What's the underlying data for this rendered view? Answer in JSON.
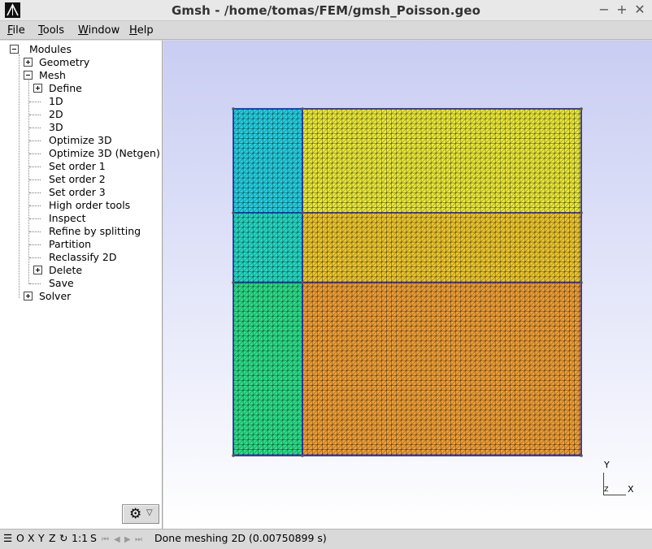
{
  "window": {
    "title": "Gmsh - /home/tomas/FEM/gmsh_Poisson.geo",
    "minimize": "−",
    "maximize": "+",
    "close": "✕"
  },
  "menu": {
    "file": "File",
    "tools": "Tools",
    "window": "Window",
    "help": "Help"
  },
  "tree": {
    "modules": "Modules",
    "geometry": "Geometry",
    "mesh": "Mesh",
    "define": "Define",
    "1d": "1D",
    "2d": "2D",
    "3d": "3D",
    "optimize3d": "Optimize 3D",
    "optimize3d_netgen": "Optimize 3D (Netgen)",
    "set_order_1": "Set order 1",
    "set_order_2": "Set order 2",
    "set_order_3": "Set order 3",
    "high_order_tools": "High order tools",
    "inspect": "Inspect",
    "refine_by_splitting": "Refine by splitting",
    "partition": "Partition",
    "reclassify_2d": "Reclassify 2D",
    "delete": "Delete",
    "save": "Save",
    "solver": "Solver"
  },
  "axes": {
    "x": "X",
    "y": "Y",
    "z": "Z"
  },
  "statusbar": {
    "menu_icon": "☰",
    "o": "O",
    "x": "X",
    "y": "Y",
    "z": "Z",
    "rotate_icon": "↻",
    "scale": "1:1",
    "s": "S",
    "first_icon": "⏮",
    "prev_icon": "◀",
    "play_icon": "▶",
    "last_icon": "⏭",
    "message": "Done meshing 2D (0.00750899 s)"
  },
  "mesh": {
    "colors": {
      "top_left": "#27d0e2",
      "mid_left": "#27dac6",
      "bottom_left": "#2ee08a",
      "top_right": "#ecea3a",
      "mid_right": "#efc82f",
      "bottom_right": "#f0a038",
      "edge": "#1a1aa6"
    },
    "icons": {
      "settings": "gear-icon",
      "dropdown": "chevron-down-icon"
    }
  }
}
